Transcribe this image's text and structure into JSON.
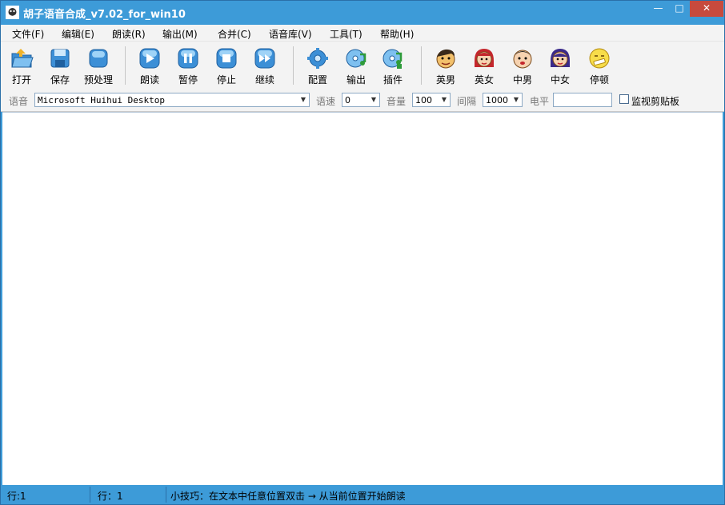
{
  "window": {
    "title": "胡子语音合成_v7.02_for_win10",
    "min_glyph": "—",
    "max_glyph": "□",
    "close_glyph": "✕"
  },
  "menu": [
    {
      "label": "文件(F)"
    },
    {
      "label": "编辑(E)"
    },
    {
      "label": "朗读(R)"
    },
    {
      "label": "输出(M)"
    },
    {
      "label": "合并(C)"
    },
    {
      "label": "语音库(V)"
    },
    {
      "label": "工具(T)"
    },
    {
      "label": "帮助(H)"
    }
  ],
  "toolbar": {
    "buttons": [
      {
        "label": "打开",
        "icon": "open-folder-icon"
      },
      {
        "label": "保存",
        "icon": "save-disk-icon"
      },
      {
        "label": "预处理",
        "icon": "preprocess-icon"
      },
      {
        "label": "朗读",
        "icon": "play-icon"
      },
      {
        "label": "暂停",
        "icon": "pause-icon"
      },
      {
        "label": "停止",
        "icon": "stop-icon"
      },
      {
        "label": "继续",
        "icon": "fast-forward-icon"
      },
      {
        "label": "配置",
        "icon": "gear-icon"
      },
      {
        "label": "输出",
        "icon": "cd-output-icon"
      },
      {
        "label": "插件",
        "icon": "cd-plugin-icon"
      },
      {
        "label": "英男",
        "icon": "english-male-face-icon"
      },
      {
        "label": "英女",
        "icon": "english-female-face-icon"
      },
      {
        "label": "中男",
        "icon": "chinese-male-face-icon"
      },
      {
        "label": "中女",
        "icon": "chinese-female-face-icon"
      },
      {
        "label": "停顿",
        "icon": "pause-face-icon"
      }
    ]
  },
  "options": {
    "voice_label": "语音",
    "voice_value": "Microsoft Huihui Desktop",
    "speed_label": "语速",
    "speed_value": "0",
    "volume_label": "音量",
    "volume_value": "100",
    "interval_label": "间隔",
    "interval_value": "1000",
    "level_label": "电平",
    "level_value": "",
    "monitor_clipboard_label": "监视剪贴板",
    "monitor_clipboard_checked": false,
    "dropdown_glyph": "▼"
  },
  "editor": {
    "text": ""
  },
  "status": {
    "line_left": "行:1",
    "line_right": "行：1",
    "tip": "小技巧：在文本中任意位置双击 → 从当前位置开始朗读"
  },
  "colors": {
    "accent": "#3d9bd8",
    "close": "#c74a3d",
    "toolbar_bg": "#f3f3f3"
  }
}
